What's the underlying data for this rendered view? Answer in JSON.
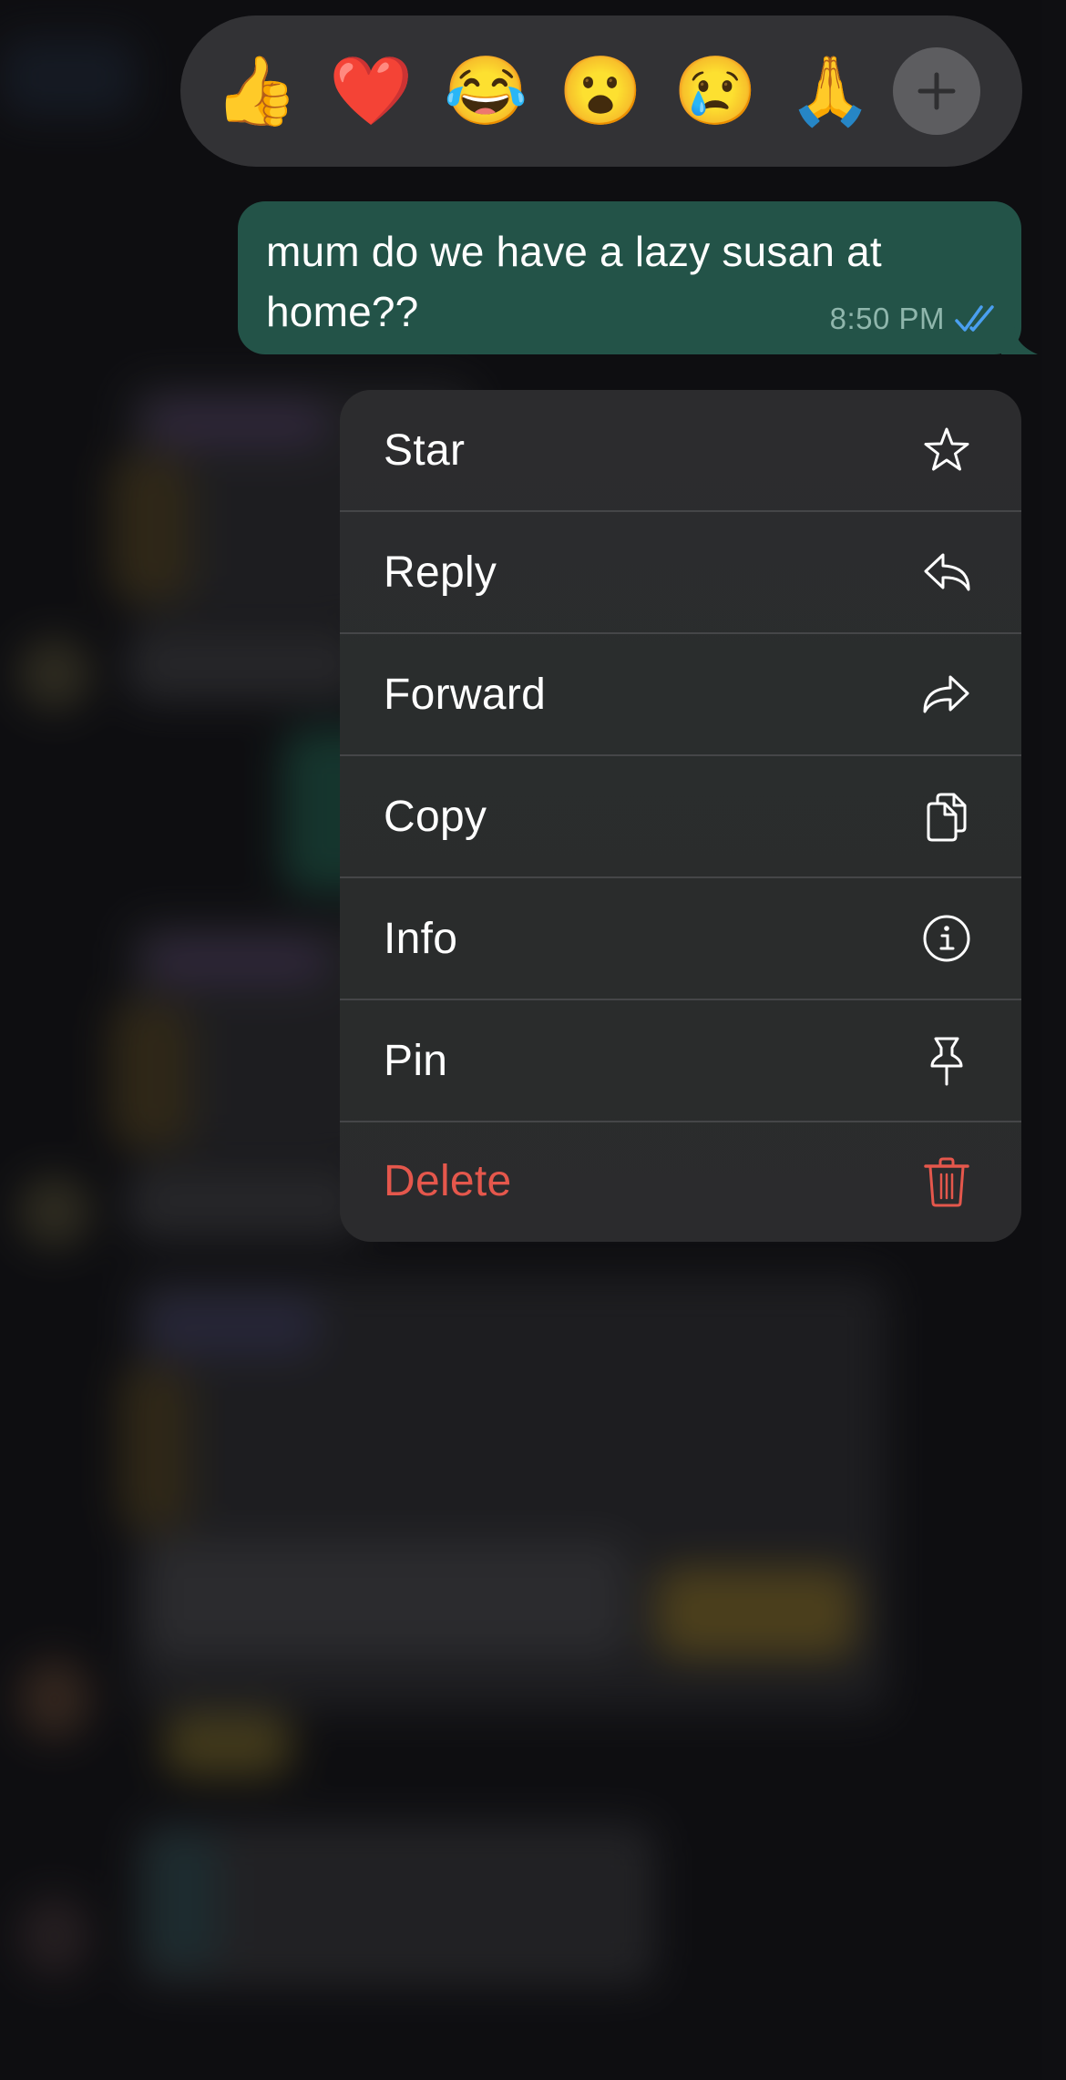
{
  "colors": {
    "bubble_outgoing": "#235348",
    "read_receipt": "#4a9ff0",
    "danger": "#e5574c",
    "menu_text": "#ffffff"
  },
  "reactions": {
    "emojis": [
      {
        "name": "thumbs-up",
        "glyph": "👍"
      },
      {
        "name": "red-heart",
        "glyph": "❤️"
      },
      {
        "name": "tears-of-joy",
        "glyph": "😂"
      },
      {
        "name": "surprised",
        "glyph": "😮"
      },
      {
        "name": "crying",
        "glyph": "😢"
      },
      {
        "name": "folded-hands",
        "glyph": "🙏"
      }
    ],
    "more_icon": "plus-icon"
  },
  "message": {
    "text": "mum do we have a lazy susan at home??",
    "time": "8:50 PM",
    "status_icon": "double-check-icon",
    "status": "read"
  },
  "context_menu": {
    "items": [
      {
        "label": "Star",
        "icon": "star-icon",
        "danger": false
      },
      {
        "label": "Reply",
        "icon": "reply-icon",
        "danger": false
      },
      {
        "label": "Forward",
        "icon": "forward-icon",
        "danger": false
      },
      {
        "label": "Copy",
        "icon": "copy-icon",
        "danger": false
      },
      {
        "label": "Info",
        "icon": "info-icon",
        "danger": false
      },
      {
        "label": "Pin",
        "icon": "pin-icon",
        "danger": false
      },
      {
        "label": "Delete",
        "icon": "trash-icon",
        "danger": true
      }
    ]
  }
}
